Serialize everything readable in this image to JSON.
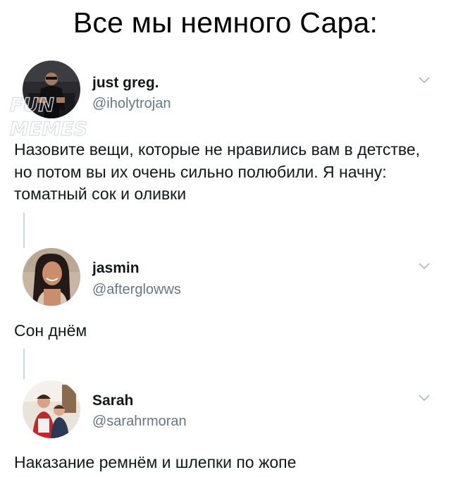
{
  "title": "Все мы немного Сара:",
  "tweets": [
    {
      "display_name": "just greg.",
      "handle": "@iholytrojan",
      "text": "Назовите вещи, которые не нравились вам в детстве, но потом вы их очень сильно полюбили. Я начну: томатный сок и оливки"
    },
    {
      "display_name": "jasmin",
      "handle": "@afterglowws",
      "text": "Сон днём"
    },
    {
      "display_name": "Sarah",
      "handle": "@sarahrmoran",
      "text": "Наказание ремнём и шлепки по жопе"
    }
  ],
  "watermark": {
    "line1": "FUN",
    "line2": "MEMES"
  },
  "icons": {
    "menu": "chevron-down-icon"
  },
  "colors": {
    "text": "#14171a",
    "secondary": "#657786",
    "thread_line": "#ccd6dd",
    "chevron": "#aab8c2"
  }
}
